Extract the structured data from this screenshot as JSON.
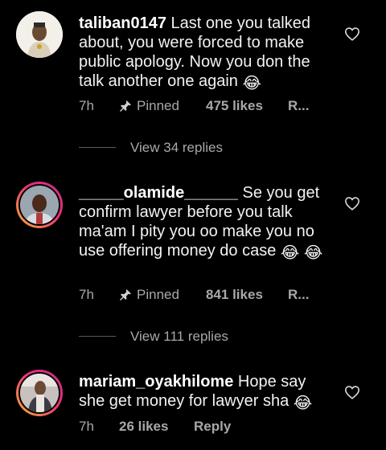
{
  "comments": [
    {
      "username": "taliban0147",
      "text": "Last one you talked about, you were forced to make public apology. Now you don the talk another one again",
      "emoji": "😂",
      "time": "7h",
      "pinned_label": "Pinned",
      "likes": "475 likes",
      "reply": "R..."
    },
    {
      "username": "_____olamide______",
      "text": "Se you get confirm lawyer before you talk ma'am I pity you oo make you no use offering money do case",
      "emoji": "😂",
      "emoji2": "😂",
      "time": "7h",
      "pinned_label": "Pinned",
      "likes": "841 likes",
      "reply": "R..."
    },
    {
      "username": "mariam_oyakhilome",
      "text": "Hope say she get money for lawyer sha",
      "emoji": "😂",
      "time": "7h",
      "likes": "26 likes",
      "reply": "Reply"
    }
  ],
  "threads": [
    {
      "label": "View 34 replies"
    },
    {
      "label": "View 111 replies"
    }
  ],
  "icons": {
    "heart": "heart-outline-icon",
    "pin": "pin-icon"
  },
  "colors": {
    "background": "#000000",
    "text": "#ffffff",
    "secondary": "#a8a8a8",
    "story_ring_start": "#f9b233",
    "story_ring_end": "#c13584"
  }
}
